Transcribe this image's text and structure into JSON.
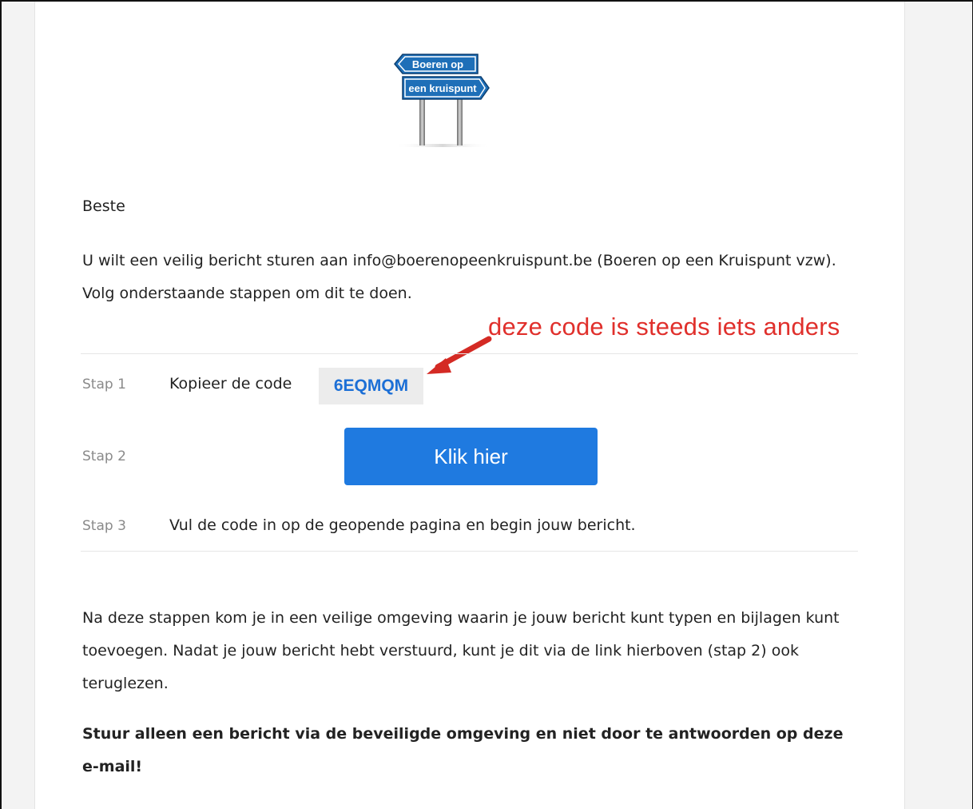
{
  "logo": {
    "line1": "Boeren op",
    "line2": "een kruispunt",
    "icon": "signpost-logo"
  },
  "email": {
    "greeting": "Beste",
    "intro": "U wilt een veilig bericht sturen aan info@boerenopeenkruispunt.be (Boeren op een Kruispunt vzw). Volg onderstaande stappen om dit te doen.",
    "steps": [
      {
        "label": "Stap 1",
        "text": "Kopieer de code",
        "code": "6EQMQM"
      },
      {
        "label": "Stap 2",
        "button": "Klik hier"
      },
      {
        "label": "Stap 3",
        "text": "Vul de code in op de geopende pagina en begin jouw bericht."
      }
    ],
    "outro": "Na deze stappen kom je in een veilige omgeving waarin je jouw bericht kunt typen en bijlagen kunt toevoegen. Nadat je jouw bericht hebt verstuurd, kunt je dit via de link hierboven (stap 2) ook teruglezen.",
    "warning": "Stuur alleen een bericht via de beveiligde omgeving en niet door te antwoorden op deze e-mail!"
  },
  "annotation": {
    "text": "deze code is steeds iets anders",
    "color": "#e0302c"
  },
  "colors": {
    "button": "#1f7ae0",
    "code": "#1c6fd6"
  }
}
